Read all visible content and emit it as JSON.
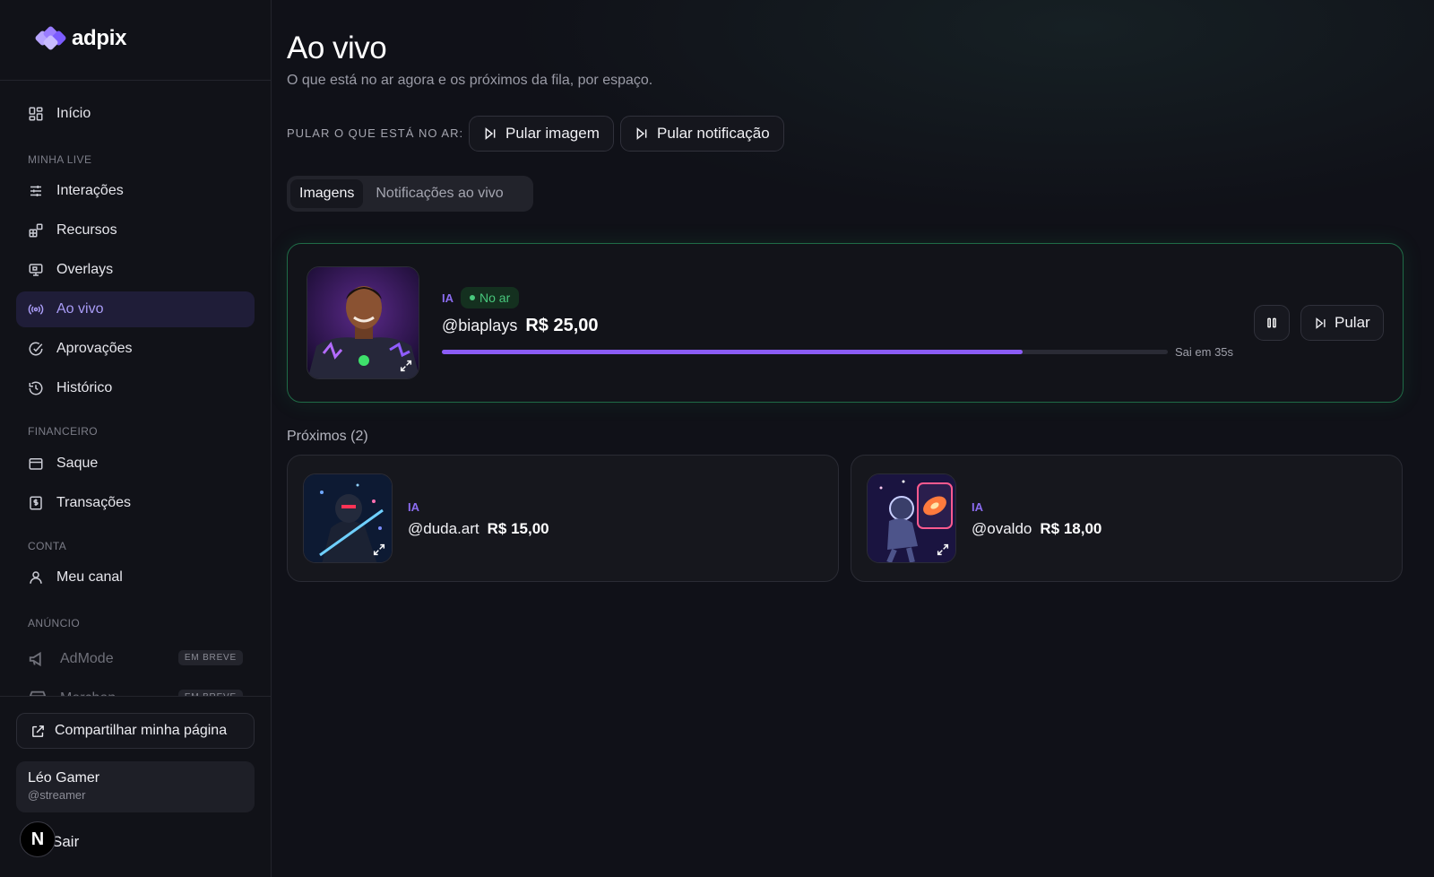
{
  "brand": {
    "name": "adpix"
  },
  "sidebar": {
    "home": "Início",
    "sections": {
      "minha_live": "MINHA LIVE",
      "financeiro": "FINANCEIRO",
      "conta": "CONTA",
      "anuncio": "ANÚNCIO"
    },
    "items": [
      {
        "label": "Interações",
        "icon": "sliders-icon"
      },
      {
        "label": "Recursos",
        "icon": "blocks-icon"
      },
      {
        "label": "Overlays",
        "icon": "monitor-icon"
      },
      {
        "label": "Ao vivo",
        "icon": "broadcast-icon",
        "active": true
      },
      {
        "label": "Aprovações",
        "icon": "check-circle-icon"
      },
      {
        "label": "Histórico",
        "icon": "history-icon"
      },
      {
        "label": "Saque",
        "icon": "wallet-icon"
      },
      {
        "label": "Transações",
        "icon": "receipt-icon"
      },
      {
        "label": "Meu canal",
        "icon": "user-icon"
      },
      {
        "label": "AdMode",
        "icon": "megaphone-icon",
        "badge": "EM BREVE",
        "disabled": true
      },
      {
        "label": "Merchan",
        "icon": "store-icon",
        "badge": "EM BREVE",
        "disabled": true
      }
    ],
    "share_button": "Compartilhar minha página",
    "user": {
      "name": "Léo Gamer",
      "handle": "@streamer"
    },
    "logout": "Sair",
    "n_badge": "N"
  },
  "page": {
    "title": "Ao vivo",
    "subtitle": "O que está no ar agora e os próximos da fila, por espaço.",
    "skip_label": "PULAR O QUE ESTÁ NO AR:",
    "skip_image": "Pular imagem",
    "skip_notification": "Pular notificação",
    "tabs": [
      "Imagens",
      "Notificações ao vivo"
    ],
    "active_tab": 0
  },
  "live": {
    "tag": "IA",
    "status": "No ar",
    "handle": "@biaplays",
    "amount": "R$ 25,00",
    "progress": 0.8,
    "remaining": "Sai em 35s",
    "skip_button": "Pular"
  },
  "queue": {
    "label": "Próximos (2)",
    "items": [
      {
        "tag": "IA",
        "handle": "@duda.art",
        "amount": "R$ 15,00"
      },
      {
        "tag": "IA",
        "handle": "@ovaldo",
        "amount": "R$ 18,00"
      }
    ]
  },
  "colors": {
    "accent": "#8b5cf6",
    "live_border": "#1f6b47",
    "on_air": "#48c77c",
    "active_nav_bg": "#1f1d38"
  }
}
